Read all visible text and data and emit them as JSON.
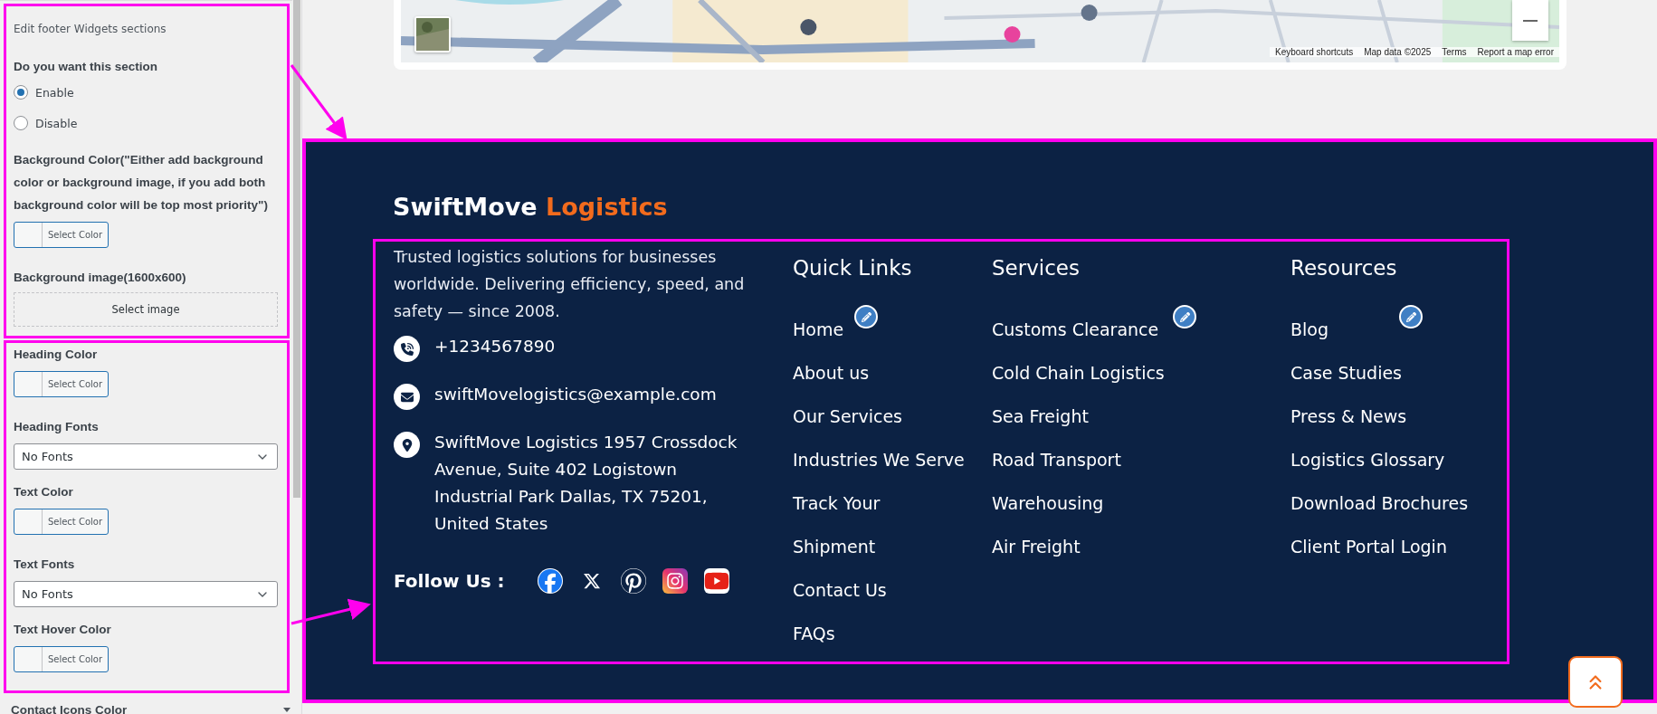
{
  "sidebar": {
    "section_title": "Edit footer Widgets sections",
    "question": "Do you want this section",
    "options": [
      {
        "label": "Enable",
        "selected": true
      },
      {
        "label": "Disable",
        "selected": false
      }
    ],
    "background_fields": [
      {
        "kind": "color",
        "label": "Background Color(\"Either add background color or background image, if you add both background color will be top most priority\")",
        "button": "Select Color"
      },
      {
        "label": "Background image(1600x600)",
        "button": "Select image"
      }
    ],
    "style_fields": [
      {
        "kind": "color",
        "label": "Heading Color",
        "button": "Select Color"
      },
      {
        "kind": "select",
        "label": "Heading Fonts",
        "value": "No Fonts"
      },
      {
        "kind": "color",
        "label": "Text Color",
        "button": "Select Color"
      },
      {
        "kind": "select",
        "label": "Text Fonts",
        "value": "No Fonts"
      },
      {
        "kind": "color",
        "label": "Text Hover Color",
        "button": "Select Color"
      }
    ],
    "collapsed_label": "Contact Icons Color"
  },
  "map": {
    "attribution": [
      "Keyboard shortcuts",
      "Map data ©2025",
      "Terms",
      "Report a map error"
    ]
  },
  "footer": {
    "brand": [
      {
        "text": "SwiftMove",
        "accent": false
      },
      {
        "text": "Logistics",
        "accent": true
      }
    ],
    "description": "Trusted logistics solutions for businesses worldwide. Delivering efficiency, speed, and safety — since 2008.",
    "contacts": [
      {
        "kind": "phone",
        "text": "+1234567890"
      },
      {
        "kind": "email",
        "text": "swiftMovelogistics@example.com"
      },
      {
        "kind": "address",
        "text": "SwiftMove Logistics 1957 Crossdock Avenue, Suite 402 Logistown Industrial Park Dallas, TX 75201, United States"
      }
    ],
    "follow_label": "Follow Us :",
    "socials": [
      {
        "kind": "facebook"
      },
      {
        "kind": "x"
      },
      {
        "kind": "pinterest"
      },
      {
        "kind": "instagram"
      },
      {
        "kind": "youtube"
      }
    ],
    "columns": [
      {
        "title": "Quick Links",
        "links": [
          {
            "label": "Home",
            "edit": true
          },
          {
            "label": "About us",
            "edit": false
          },
          {
            "label": "Our Services",
            "edit": false
          },
          {
            "label": "Industries We Serve",
            "edit": false
          },
          {
            "label": "Track Your",
            "edit": false
          },
          {
            "label": "Shipment",
            "edit": false
          },
          {
            "label": "Contact Us",
            "edit": false
          },
          {
            "label": "FAQs",
            "edit": false
          }
        ]
      },
      {
        "title": "Services",
        "links": [
          {
            "label": "Customs Clearance",
            "edit": true
          },
          {
            "label": "Cold Chain Logistics",
            "edit": false
          },
          {
            "label": "Sea Freight",
            "edit": false
          },
          {
            "label": "Road Transport",
            "edit": false
          },
          {
            "label": "Warehousing",
            "edit": false
          },
          {
            "label": "Air Freight",
            "edit": false
          }
        ]
      },
      {
        "title": "Resources",
        "links": [
          {
            "label": "Blog",
            "edit": true
          },
          {
            "label": "Case Studies",
            "edit": false
          },
          {
            "label": "Press & News",
            "edit": false
          },
          {
            "label": "Logistics Glossary",
            "edit": false
          },
          {
            "label": "Download Brochures",
            "edit": false
          },
          {
            "label": "Client Portal Login",
            "edit": false
          }
        ]
      }
    ]
  }
}
